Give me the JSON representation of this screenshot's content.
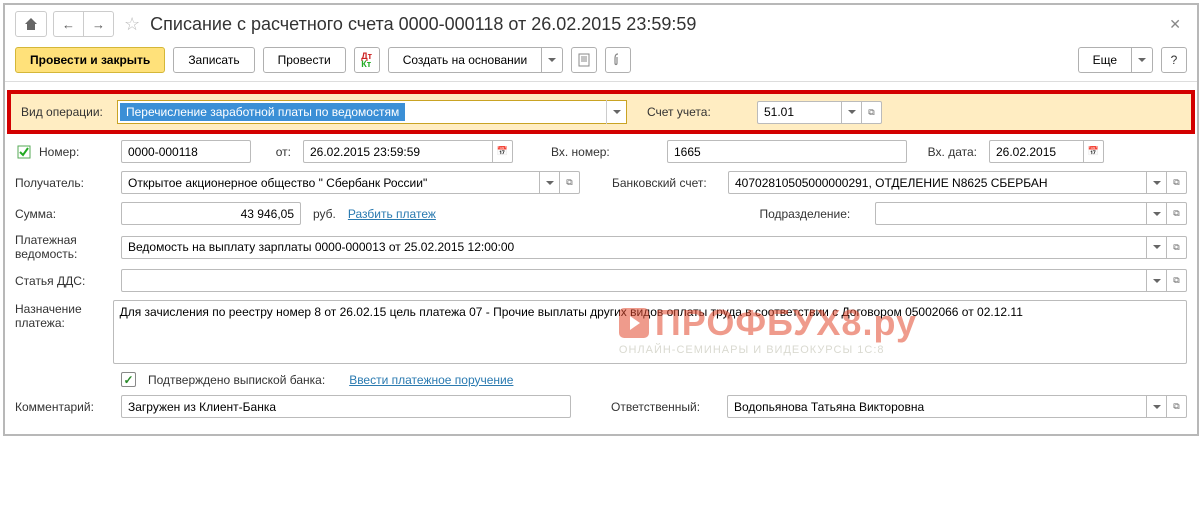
{
  "title": "Списание с расчетного счета 0000-000118 от 26.02.2015 23:59:59",
  "toolbar": {
    "post_close": "Провести и закрыть",
    "save": "Записать",
    "post": "Провести",
    "create_based": "Создать на основании",
    "more": "Еще"
  },
  "highlight": {
    "label": "Вид операции:",
    "value": "Перечисление заработной платы по ведомостям",
    "account_label": "Счет учета:",
    "account": "51.01"
  },
  "fields": {
    "number_label": "Номер:",
    "number": "0000-000118",
    "from_label": "от:",
    "date": "26.02.2015 23:59:59",
    "in_number_label": "Вх. номер:",
    "in_number": "1665",
    "in_date_label": "Вх. дата:",
    "in_date": "26.02.2015",
    "recipient_label": "Получатель:",
    "recipient": "Открытое акционерное общество \" Сбербанк России\"",
    "bank_account_label": "Банковский счет:",
    "bank_account": "40702810505000000291, ОТДЕЛЕНИЕ N8625 СБЕРБАН",
    "sum_label": "Сумма:",
    "sum": "43 946,05",
    "currency": "руб.",
    "split_link": "Разбить платеж",
    "division_label": "Подразделение:",
    "division": "",
    "statement_label": "Платежная ведомость:",
    "statement": "Ведомость на выплату зарплаты 0000-000013 от 25.02.2015 12:00:00",
    "dds_label": "Статья ДДС:",
    "dds": "",
    "purpose_label": "Назначение платежа:",
    "purpose": "Для зачисления по реестру номер 8 от 26.02.15 цель платежа 07 - Прочие выплаты других видов оплаты труда в соответствии с Договором 05002066 от 02.12.11",
    "confirmed_label": "Подтверждено выпиской банка:",
    "enter_order_link": "Ввести платежное поручение",
    "comment_label": "Комментарий:",
    "comment": "Загружен из Клиент-Банка",
    "responsible_label": "Ответственный:",
    "responsible": "Водопьянова Татьяна Викторовна"
  },
  "watermark": {
    "main": "ПРОФБУХ8.ру",
    "sub": "ОНЛАЙН-СЕМИНАРЫ И ВИДЕОКУРСЫ 1С:8"
  }
}
